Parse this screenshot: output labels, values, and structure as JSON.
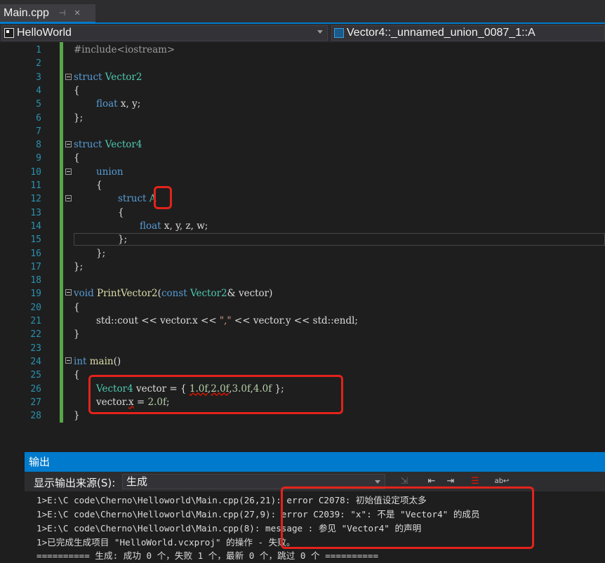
{
  "tab": {
    "title": "Main.cpp",
    "pin_icon": "pin-icon",
    "close_icon": "close-icon"
  },
  "nav": {
    "project": "HelloWorld",
    "member": "Vector4::_unnamed_union_0087_1::A"
  },
  "code_lines": [
    "1",
    "2",
    "3",
    "4",
    "5",
    "6",
    "7",
    "8",
    "9",
    "10",
    "11",
    "12",
    "13",
    "14",
    "15",
    "16",
    "17",
    "18",
    "19",
    "20",
    "21",
    "22",
    "23",
    "24",
    "25",
    "26",
    "27",
    "28"
  ],
  "code": {
    "l1": "#include<iostream>",
    "l3_kw": "struct",
    "l3_name": "Vector2",
    "l4": "{",
    "l5_kw": "float",
    "l5_rest": "x, y;",
    "l6": "};",
    "l8_kw": "struct",
    "l8_name": "Vector4",
    "l9": "{",
    "l10": "union",
    "l11": "{",
    "l12_kw": "struct",
    "l12_name": "A",
    "l13": "{",
    "l14_kw": "float",
    "l14_rest": "x, y, z, w;",
    "l15": "};",
    "l16": "};",
    "l17": "};",
    "l19_kw": "void",
    "l19_fn": "PrintVector2",
    "l19_p1": "(",
    "l19_const": "const",
    "l19_ty": "Vector2",
    "l19_rest": "& vector)",
    "l20": "{",
    "l21_a": "std::cout << vector.x << ",
    "l21_str": "\",\"",
    "l21_b": " << vector.y << std::endl;",
    "l22": "}",
    "l24_kw": "int",
    "l24_fn": "main",
    "l24_rest": "()",
    "l25": "{",
    "l26_ty": "Vector4",
    "l26_a": " vector = { ",
    "l26_n1": "1.0f",
    "l26_c1": ",",
    "l26_n2": "2.0f",
    "l26_c2": ",",
    "l26_n3": "3.0f",
    "l26_c3": ",",
    "l26_n4": "4.0f",
    "l26_b": " };",
    "l27_a": "vector.",
    "l27_x": "x",
    "l27_b": " = ",
    "l27_n": "2.0f",
    "l27_c": ";",
    "l28": "}"
  },
  "output": {
    "title": "输出",
    "source_label": "显示输出来源(S):",
    "source_value": "生成",
    "lines": [
      "1>E:\\C code\\Cherno\\Helloworld\\Main.cpp(26,21): error C2078: 初始值设定项太多",
      "1>E:\\C code\\Cherno\\Helloworld\\Main.cpp(27,9): error C2039: \"x\": 不是 \"Vector4\" 的成员",
      "1>E:\\C code\\Cherno\\Helloworld\\Main.cpp(8): message : 参见 \"Vector4\" 的声明",
      "1>已完成生成项目 \"HelloWorld.vcxproj\" 的操作 - 失败。",
      "========== 生成: 成功 0 个，失败 1 个，最新 0 个，跳过 0 个 =========="
    ]
  },
  "colors": {
    "accent": "#007acc",
    "annotation": "#e3231b",
    "keyword": "#569cd6",
    "type": "#4ec9b0"
  }
}
